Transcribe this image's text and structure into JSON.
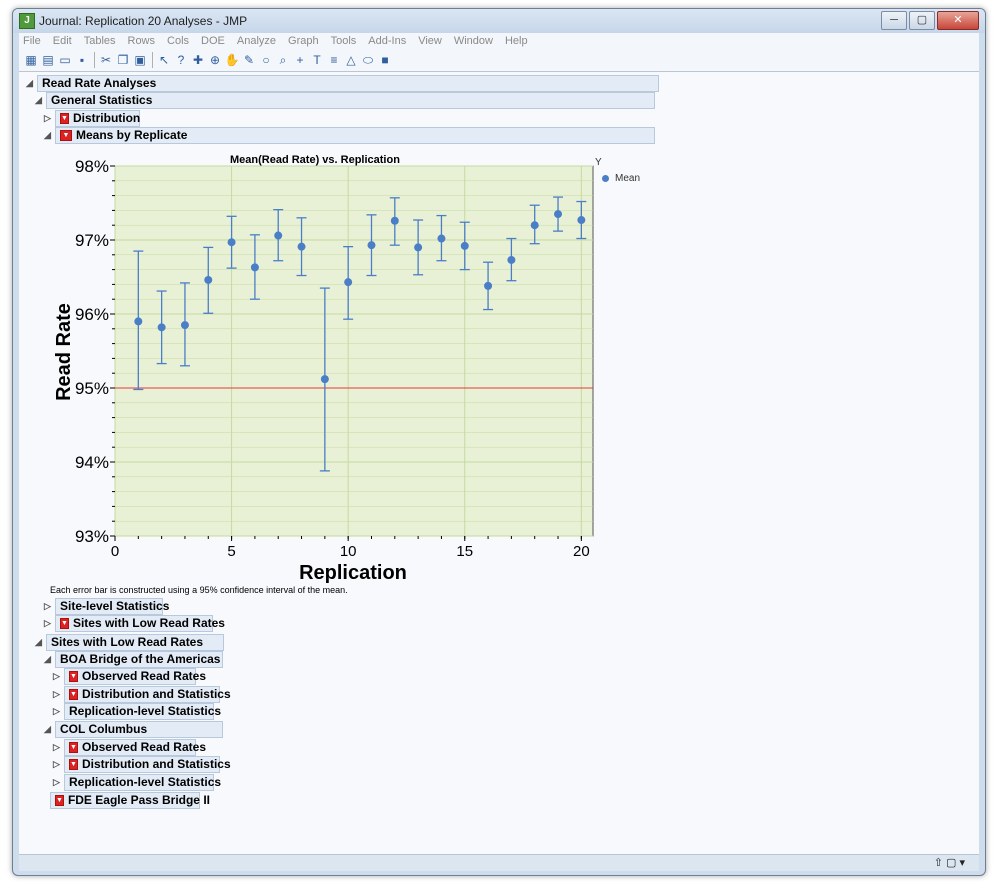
{
  "window": {
    "title": "Journal: Replication 20 Analyses - JMP",
    "buttons": [
      "─",
      "▢",
      "✕"
    ]
  },
  "menu": [
    "File",
    "Edit",
    "Tables",
    "Rows",
    "Cols",
    "DOE",
    "Analyze",
    "Graph",
    "Tools",
    "Add-Ins",
    "View",
    "Window",
    "Help"
  ],
  "toolbar_icons": [
    "new-data-table-icon",
    "new-script-icon",
    "open-icon",
    "save-icon",
    "cut-icon",
    "copy-icon",
    "paste-icon",
    "arrow-icon",
    "help-icon",
    "crosshair-icon",
    "lasso-icon",
    "hand-icon",
    "brush-icon",
    "magnifier-icon",
    "zoom-icon",
    "plus-icon",
    "text-icon",
    "lines-icon",
    "polygon-icon",
    "oval-icon",
    "block-icon"
  ],
  "tree": {
    "read_rate": "Read Rate Analyses",
    "general": "General Statistics",
    "distribution": "Distribution",
    "means": "Means by Replicate",
    "site_level": "Site-level Statistics",
    "sites_low": "Sites with Low Read Rates",
    "sites_low2": "Sites with Low Read Rates",
    "boa": "BOA Bridge of the Americas",
    "observed1": "Observed Read Rates",
    "dist_stats1": "Distribution and Statistics",
    "rep_stats1": "Replication-level Statistics",
    "col": "COL Columbus",
    "observed2": "Observed Read Rates",
    "dist_stats2": "Distribution and Statistics",
    "rep_stats2": "Replication-level Statistics",
    "fde": "FDE Eagle Pass Bridge II"
  },
  "chart_data": {
    "type": "scatter",
    "title": "Mean(Read Rate) vs. Replication",
    "xlabel": "Replication",
    "ylabel": "Read Rate",
    "xlim": [
      0,
      20.5
    ],
    "ylim": [
      93,
      98
    ],
    "xticks": [
      0,
      5,
      10,
      15,
      20
    ],
    "yticks": [
      93,
      94,
      95,
      96,
      97,
      98
    ],
    "ytick_labels": [
      "93%",
      "94%",
      "95%",
      "96%",
      "97%",
      "98%"
    ],
    "legend_title": "Y",
    "legend_entry": "Mean",
    "reference_line": 95,
    "x": [
      1,
      2,
      3,
      4,
      5,
      6,
      7,
      8,
      9,
      10,
      11,
      12,
      13,
      14,
      15,
      16,
      17,
      18,
      19,
      20
    ],
    "mean": [
      95.9,
      95.82,
      95.85,
      96.46,
      96.97,
      96.63,
      97.06,
      96.91,
      95.12,
      96.43,
      96.93,
      97.26,
      96.9,
      97.02,
      96.92,
      96.38,
      96.73,
      97.2,
      97.35,
      97.27
    ],
    "lower": [
      94.98,
      95.33,
      95.3,
      96.01,
      96.62,
      96.2,
      96.72,
      96.52,
      93.88,
      95.93,
      96.52,
      96.93,
      96.53,
      96.72,
      96.6,
      96.06,
      96.45,
      96.95,
      97.12,
      97.02
    ],
    "upper": [
      96.85,
      96.31,
      96.42,
      96.9,
      97.32,
      97.07,
      97.41,
      97.3,
      96.35,
      96.91,
      97.34,
      97.57,
      97.27,
      97.33,
      97.24,
      96.7,
      97.02,
      97.47,
      97.58,
      97.52
    ],
    "colors": {
      "plot_bg": "#e8f1d6",
      "point": "#4a7ec7",
      "ref_line": "#e23b3b",
      "grid": "#c6d9a0"
    }
  },
  "chart_note": "Each error bar is constructed using a 95% confidence interval of the mean.",
  "status_icons": "⇧ ▢ ▾"
}
